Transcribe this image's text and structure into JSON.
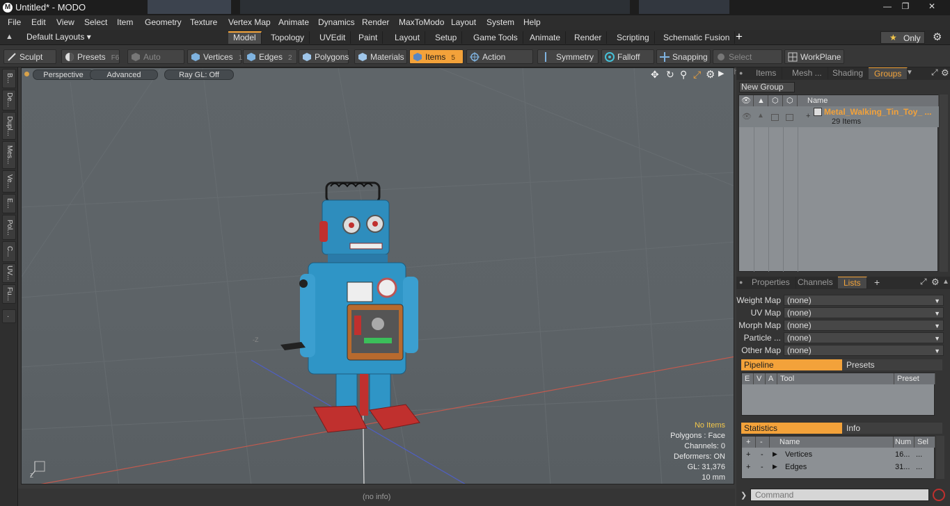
{
  "window": {
    "title": "Untitled* - MODO",
    "app_icon": "modo-logo-icon",
    "controls": [
      "minimize-icon",
      "restore-icon",
      "close-icon"
    ]
  },
  "menu": [
    "File",
    "Edit",
    "View",
    "Select",
    "Item",
    "Geometry",
    "Texture",
    "Vertex Map",
    "Animate",
    "Dynamics",
    "Render",
    "MaxToModo",
    "Layout",
    "System",
    "Help"
  ],
  "layouts": {
    "selector_label": "Default Layouts ▾",
    "tabs": [
      "Model",
      "Topology",
      "UVEdit",
      "Paint",
      "Layout",
      "Setup",
      "Game Tools",
      "Animate",
      "Render",
      "Scripting",
      "Schematic Fusion"
    ],
    "active_tab": "Model",
    "add_label": "+",
    "only_label": "Only"
  },
  "toolbar": {
    "sculpt": "Sculpt",
    "presets": "Presets",
    "presets_key": "F6",
    "auto_select": "Auto Select",
    "vertices": "Vertices",
    "vertices_key": "1",
    "edges": "Edges",
    "edges_key": "2",
    "polygons": "Polygons",
    "materials": "Materials",
    "items": "Items",
    "items_key": "5",
    "action_center": "Action Center",
    "symmetry": "Symmetry",
    "falloff": "Falloff",
    "snapping": "Snapping",
    "select_through": "Select Through",
    "workplane": "WorkPlane"
  },
  "left_tabs": [
    "B...",
    "De...",
    "Dupl...",
    "Mes...",
    "Ve...",
    "E...",
    "Pol...",
    "C...",
    "UV...",
    "Fu..."
  ],
  "viewport": {
    "view_label": "Perspective",
    "shading_label": "Advanced",
    "raygl_label": "Ray GL: Off",
    "axis_z_label": "-Z",
    "hud": {
      "selection": "No Items",
      "polygons": "Polygons : Face",
      "channels": "Channels: 0",
      "deformers": "Deformers: ON",
      "gl": "GL: 31,376",
      "scale": "10 mm"
    }
  },
  "status": {
    "info": "(no info)"
  },
  "right_panel": {
    "top_tabs": [
      "Items",
      "Mesh ...",
      "Shading",
      "Groups"
    ],
    "active_top_tab": "Groups",
    "new_group": "New Group",
    "name_header": "Name",
    "group_name": "Metal_Walking_Tin_Toy_ ...",
    "group_count": "29 Items",
    "mid_tabs": [
      "Properties",
      "Channels",
      "Lists"
    ],
    "active_mid_tab": "Lists",
    "maps": [
      {
        "label": "Weight Map",
        "value": "(none)"
      },
      {
        "label": "UV Map",
        "value": "(none)"
      },
      {
        "label": "Morph Map",
        "value": "(none)"
      },
      {
        "label": "Particle ...",
        "value": "(none)"
      },
      {
        "label": "Other Map",
        "value": "(none)"
      }
    ],
    "pipeline_label": "Pipeline",
    "presets_label": "Presets",
    "pipeline_headers": [
      "E",
      "V",
      "A",
      "Tool",
      "Preset"
    ],
    "statistics_label": "Statistics",
    "info_label": "Info",
    "stats_headers": [
      "+",
      "-",
      "Name",
      "Num",
      "Sel"
    ],
    "stats_rows": [
      {
        "plus": "+",
        "minus": "-",
        "name": "Vertices",
        "num": "16...",
        "sel": "..."
      },
      {
        "plus": "+",
        "minus": "-",
        "name": "Edges",
        "num": "31...",
        "sel": "..."
      }
    ],
    "command_placeholder": "Command"
  },
  "colors": {
    "accent": "#f3a23a",
    "viewport_bg": "#5f6569",
    "grid_line": "#6e7478"
  }
}
